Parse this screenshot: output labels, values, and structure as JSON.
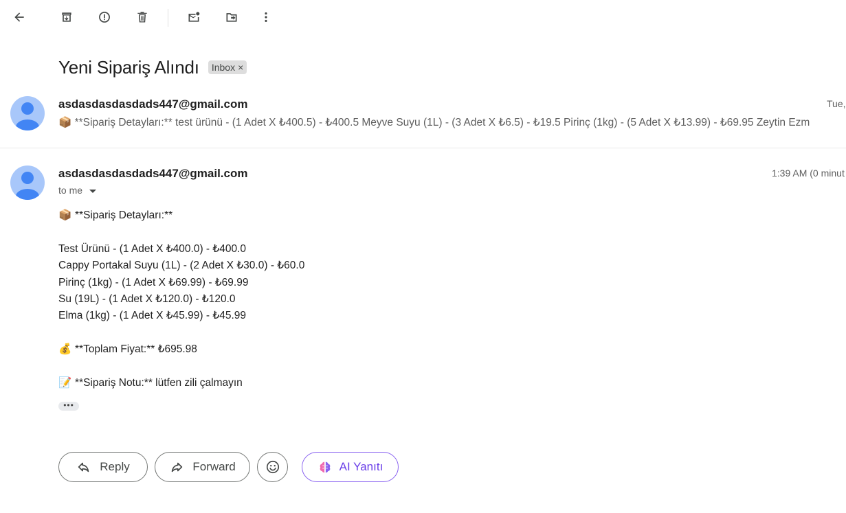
{
  "toolbar": {
    "icons": [
      "back-arrow-icon",
      "archive-icon",
      "report-spam-icon",
      "delete-icon",
      "mark-unread-icon",
      "move-to-icon",
      "more-vert-icon"
    ]
  },
  "email": {
    "subject": "Yeni Sipariş Alındı",
    "label": "Inbox",
    "label_close": "×"
  },
  "message1": {
    "sender": "asdasdasdasdads447@gmail.com",
    "date": "Tue,",
    "snippet": "📦 **Sipariş Detayları:** test ürünü - (1 Adet X ₺400.5) - ₺400.5 Meyve Suyu (1L) - (3 Adet X ₺6.5) - ₺19.5 Pirinç (1kg) - (5 Adet X ₺13.99) - ₺69.95 Zeytin Ezm"
  },
  "message2": {
    "sender": "asdasdasdasdads447@gmail.com",
    "time": "1:39 AM (0 minut",
    "recipient": "to me",
    "details_header_emoji": "📦",
    "details_header": "**Sipariş Detayları:**",
    "items": [
      "Test Ürünü - (1 Adet X ₺400.0) - ₺400.0",
      "Cappy Portakal Suyu (1L) - (2 Adet X ₺30.0) - ₺60.0",
      "Pirinç (1kg) - (1 Adet X ₺69.99) - ₺69.99",
      "Su (19L) - (1 Adet X ₺120.0) - ₺120.0",
      "Elma (1kg) - (1 Adet X ₺45.99) - ₺45.99"
    ],
    "total_emoji": "💰",
    "total": "**Toplam Fiyat:** ₺695.98",
    "note_emoji": "📝",
    "note": "**Sipariş Notu:** lütfen zili çalmayın",
    "more": "•••"
  },
  "actions": {
    "reply": "Reply",
    "forward": "Forward",
    "ai_reply": "AI Yanıtı"
  },
  "colors": {
    "avatar_bg": "#a8c7fa",
    "avatar_fg": "#4285f4",
    "ai_accent": "#6a3fe8"
  }
}
